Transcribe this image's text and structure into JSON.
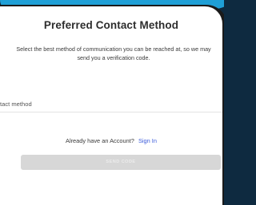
{
  "form": {
    "title": "Preferred Contact Method",
    "description": "Select the best method of communication you can be reached at, so we may send you a verification code.",
    "contact_method_label": "tact method",
    "account_prompt": "Already have an Account?",
    "sign_in_label": "Sign In",
    "send_button_label": "SEND CODE"
  },
  "colors": {
    "accent": "#1f9fd6",
    "link": "#3b5bdb",
    "button_disabled": "#d7d7d7"
  }
}
